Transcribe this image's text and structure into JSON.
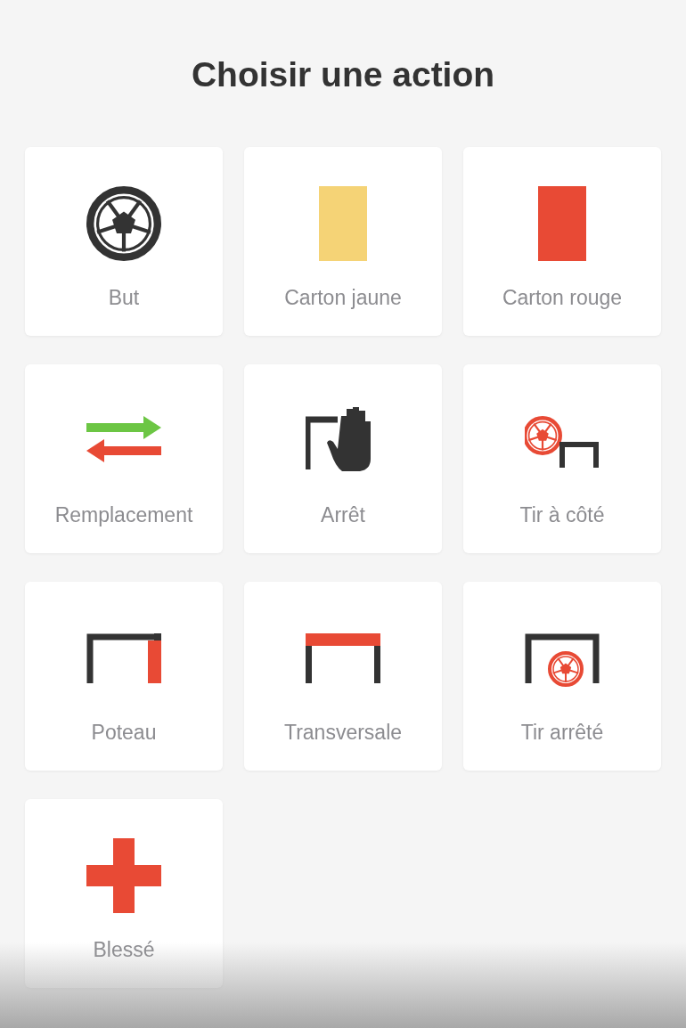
{
  "title": "Choisir une action",
  "actions": [
    {
      "label": "But",
      "kind": "goal"
    },
    {
      "label": "Carton jaune",
      "kind": "yellow-card"
    },
    {
      "label": "Carton rouge",
      "kind": "red-card"
    },
    {
      "label": "Remplacement",
      "kind": "substitution"
    },
    {
      "label": "Arrêt",
      "kind": "save"
    },
    {
      "label": "Tir à côté",
      "kind": "miss"
    },
    {
      "label": "Poteau",
      "kind": "post"
    },
    {
      "label": "Transversale",
      "kind": "crossbar"
    },
    {
      "label": "Tir arrêté",
      "kind": "shot-saved"
    },
    {
      "label": "Blessé",
      "kind": "injury"
    }
  ]
}
